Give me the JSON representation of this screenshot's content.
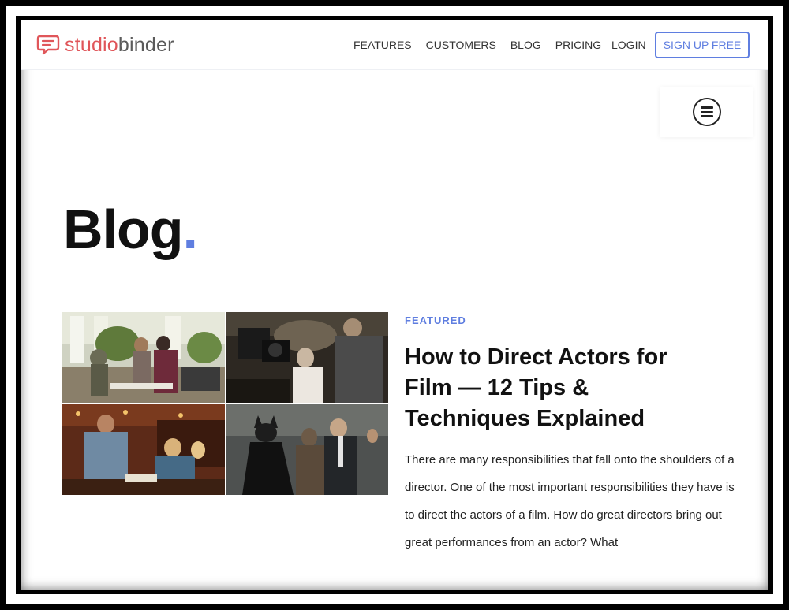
{
  "brand": {
    "name_part1": "studio",
    "name_part2": "binder",
    "accent_color": "#5f7ee0",
    "logo_color": "#e0565a"
  },
  "nav": {
    "links": [
      "FEATURES",
      "CUSTOMERS",
      "BLOG",
      "PRICING"
    ],
    "login_label": "LOGIN",
    "signup_label": "SIGN UP FREE"
  },
  "page": {
    "title": "Blog",
    "title_dot": "."
  },
  "featured": {
    "tag": "FEATURED",
    "title": "How to Direct Actors for Film — 12 Tips & Techniques Explained",
    "excerpt": "There are many responsibilities that fall onto the shoulders of a director. One of the most important responsibilities they have is to direct the actors of a film. How do great directors bring out great performances from an actor? What"
  },
  "icons": {
    "logo": "chat-bubble-icon",
    "menu": "hamburger-menu-icon"
  }
}
